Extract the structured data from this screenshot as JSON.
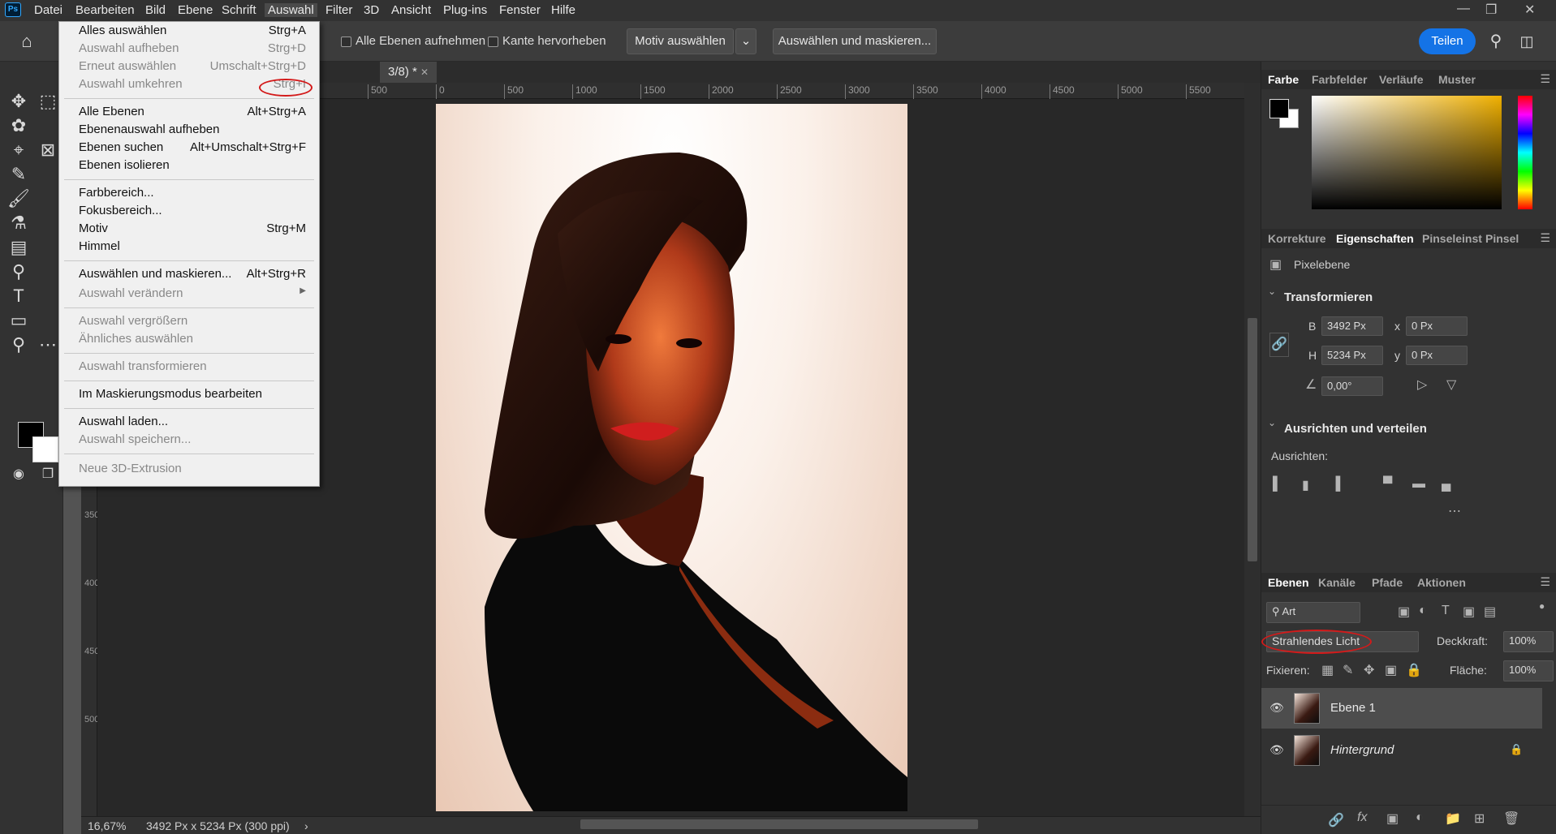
{
  "app": {
    "logo": "Ps"
  },
  "menubar": {
    "items": [
      "Datei",
      "Bearbeiten",
      "Bild",
      "Ebene",
      "Schrift",
      "Auswahl",
      "Filter",
      "3D",
      "Ansicht",
      "Plug-ins",
      "Fenster",
      "Hilfe"
    ],
    "active": "Auswahl"
  },
  "optionsbar": {
    "sample_all_layers": "Alle Ebenen aufnehmen",
    "enhance_edge": "Kante hervorheben",
    "select_subject": "Motiv auswählen",
    "select_and_mask": "Auswählen und maskieren...",
    "share": "Teilen"
  },
  "document": {
    "tab_title": "3/8) *",
    "ruler_h": [
      "500",
      "0",
      "500",
      "1000",
      "1500",
      "2000",
      "2500",
      "3000",
      "3500",
      "4000",
      "4500",
      "5000",
      "5500"
    ],
    "ruler_v": [
      "3500",
      "4000",
      "4500",
      "5000"
    ],
    "zoom": "16,67%",
    "doc_info": "3492 Px x 5234 Px (300 ppi)"
  },
  "dropdown": {
    "items": [
      {
        "label": "Alles auswählen",
        "shortcut": "Strg+A",
        "enabled": true
      },
      {
        "label": "Auswahl aufheben",
        "shortcut": "Strg+D",
        "enabled": false
      },
      {
        "label": "Erneut auswählen",
        "shortcut": "Umschalt+Strg+D",
        "enabled": false
      },
      {
        "label": "Auswahl umkehren",
        "shortcut": "Strg+I",
        "enabled": false
      },
      {
        "label": "Alle Ebenen",
        "shortcut": "Alt+Strg+A",
        "enabled": true
      },
      {
        "label": "Ebenenauswahl aufheben",
        "shortcut": "",
        "enabled": true
      },
      {
        "label": "Ebenen suchen",
        "shortcut": "Alt+Umschalt+Strg+F",
        "enabled": true
      },
      {
        "label": "Ebenen isolieren",
        "shortcut": "",
        "enabled": true
      },
      {
        "label": "Farbbereich...",
        "shortcut": "",
        "enabled": true
      },
      {
        "label": "Fokusbereich...",
        "shortcut": "",
        "enabled": true
      },
      {
        "label": "Motiv",
        "shortcut": "Strg+M",
        "enabled": true
      },
      {
        "label": "Himmel",
        "shortcut": "",
        "enabled": true
      },
      {
        "label": "Auswählen und maskieren...",
        "shortcut": "Alt+Strg+R",
        "enabled": true
      },
      {
        "label": "Auswahl verändern",
        "shortcut": "",
        "enabled": false
      },
      {
        "label": "Auswahl vergrößern",
        "shortcut": "",
        "enabled": false
      },
      {
        "label": "Ähnliches auswählen",
        "shortcut": "",
        "enabled": false
      },
      {
        "label": "Auswahl transformieren",
        "shortcut": "",
        "enabled": false
      },
      {
        "label": "Im Maskierungsmodus bearbeiten",
        "shortcut": "",
        "enabled": true
      },
      {
        "label": "Auswahl laden...",
        "shortcut": "",
        "enabled": true
      },
      {
        "label": "Auswahl speichern...",
        "shortcut": "",
        "enabled": false
      },
      {
        "label": "Neue 3D-Extrusion",
        "shortcut": "",
        "enabled": false
      }
    ]
  },
  "color_panel": {
    "tabs": [
      "Farbe",
      "Farbfelder",
      "Verläufe",
      "Muster"
    ],
    "active": "Farbe",
    "hue_color": "#f0b000"
  },
  "properties_panel": {
    "tabs": [
      "Korrekture",
      "Eigenschaften",
      "Pinseleinst",
      "Pinsel"
    ],
    "active": "Eigenschaften",
    "layer_type": "Pixelebene",
    "transform_title": "Transformieren",
    "w_label": "B",
    "w_value": "3492 Px",
    "h_label": "H",
    "h_value": "5234 Px",
    "x_label": "x",
    "x_value": "0 Px",
    "y_label": "y",
    "y_value": "0 Px",
    "angle_value": "0,00°",
    "align_title": "Ausrichten und verteilen",
    "align_label": "Ausrichten:"
  },
  "layers_panel": {
    "tabs": [
      "Ebenen",
      "Kanäle",
      "Pfade",
      "Aktionen"
    ],
    "active": "Ebenen",
    "filter_label": "Art",
    "blend_mode": "Strahlendes Licht",
    "opacity_label": "Deckkraft:",
    "opacity_value": "100%",
    "lock_label": "Fixieren:",
    "fill_label": "Fläche:",
    "fill_value": "100%",
    "layers": [
      {
        "name": "Ebene 1",
        "selected": true
      },
      {
        "name": "Hintergrund",
        "selected": false,
        "locked": true
      }
    ]
  }
}
